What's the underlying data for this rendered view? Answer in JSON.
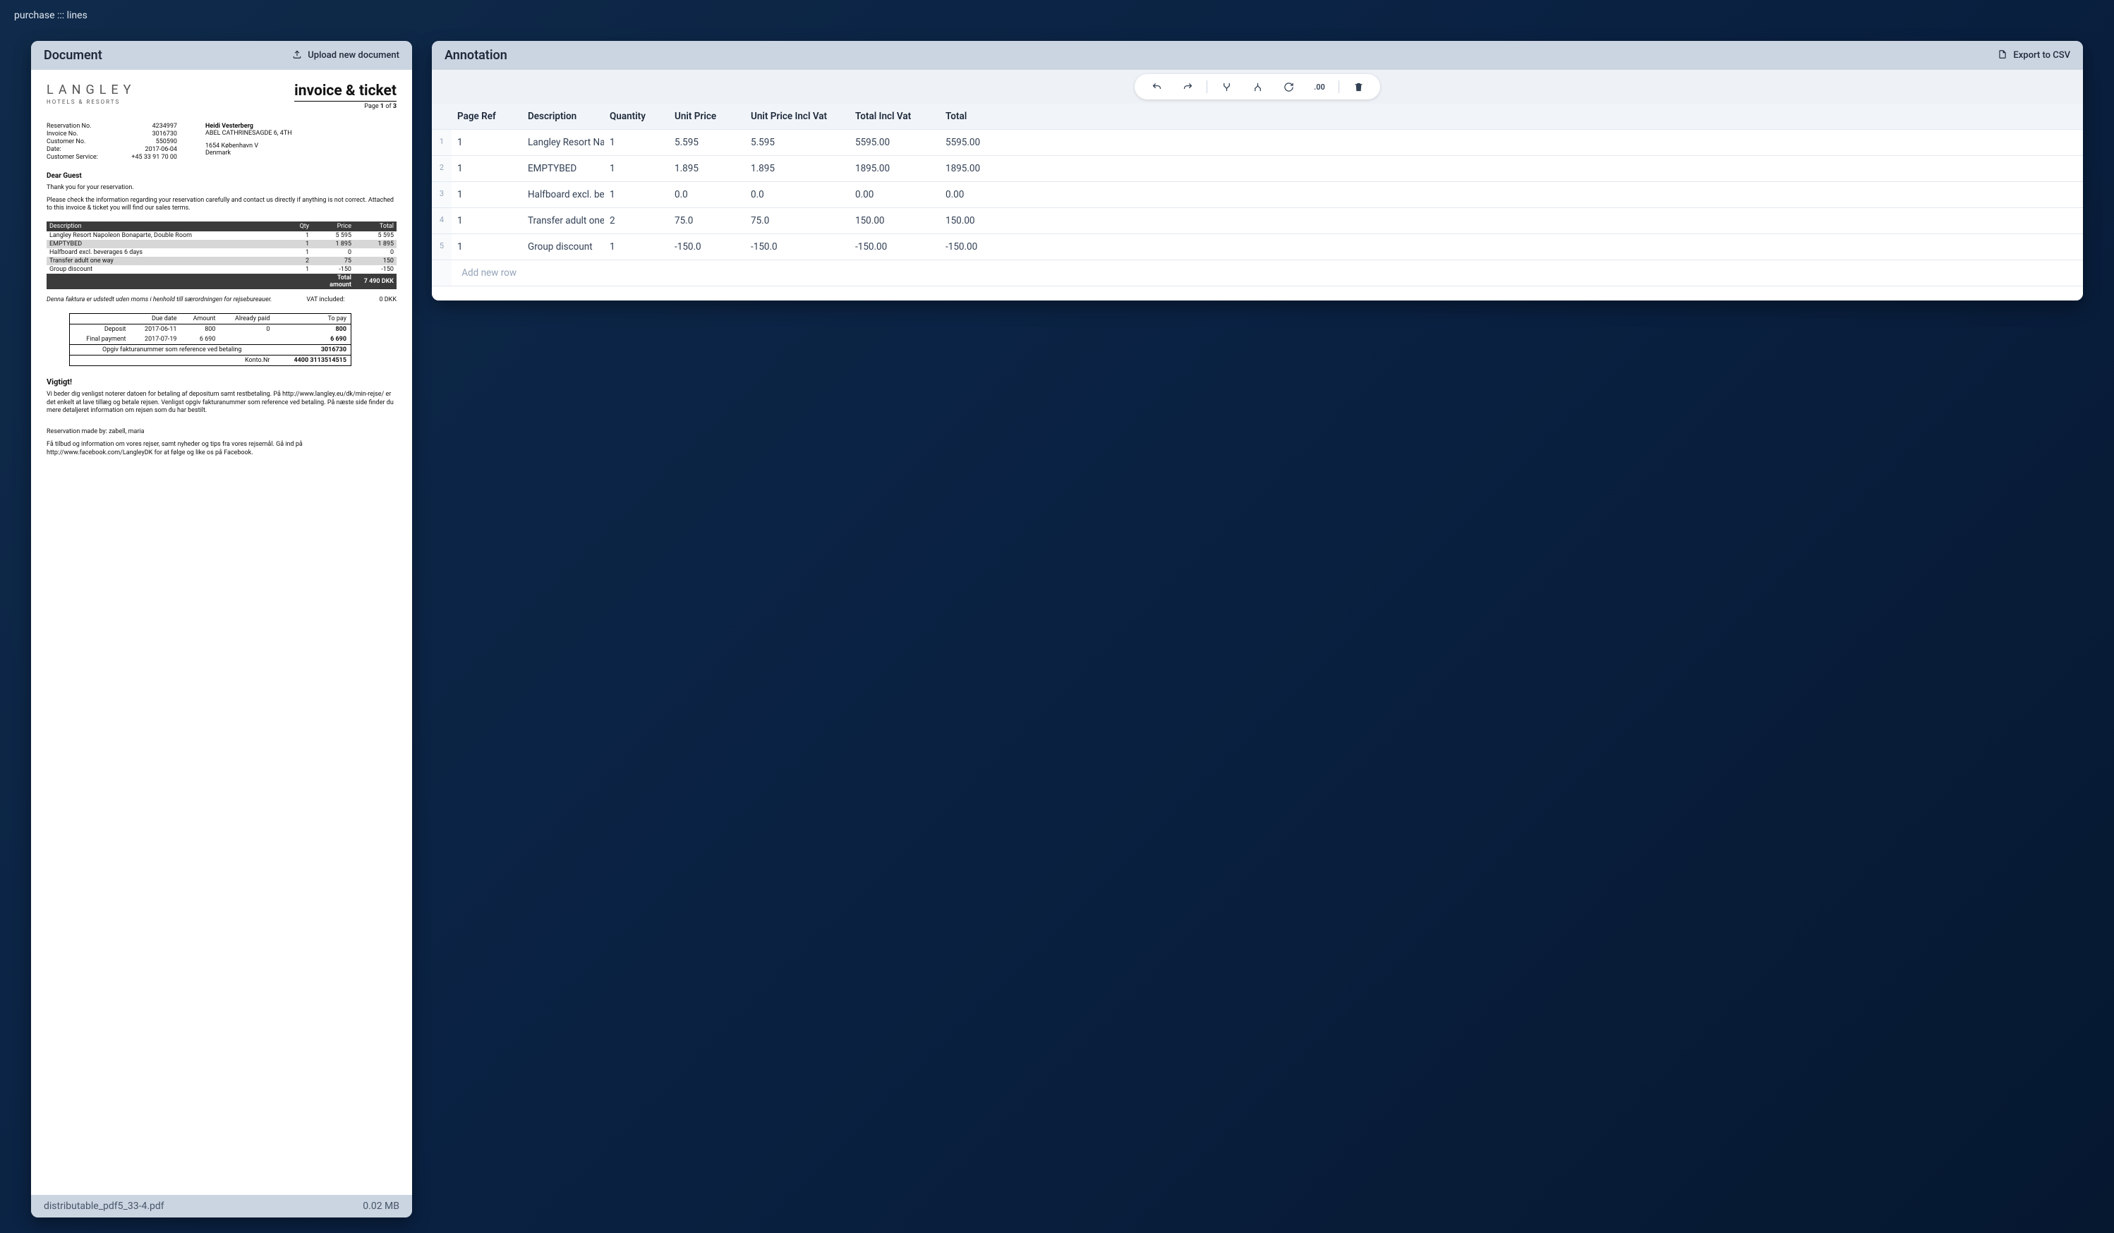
{
  "breadcrumb": "purchase ::: lines",
  "document_panel": {
    "title": "Document",
    "upload_label": "Upload new document",
    "filename": "distributable_pdf5_33-4.pdf",
    "filesize": "0.02 MB"
  },
  "annotation_panel": {
    "title": "Annotation",
    "export_label": "Export to CSV",
    "add_row_label": "Add new row",
    "toolbar": {
      "decimal_label": ".00"
    },
    "columns": [
      "Page Ref",
      "Description",
      "Quantity",
      "Unit Price",
      "Unit Price Incl Vat",
      "Total Incl Vat",
      "Total"
    ],
    "rows": [
      {
        "idx": "1",
        "page_ref": "1",
        "description": "Langley Resort Na",
        "quantity": "1",
        "unit_price": "5.595",
        "unit_price_incl_vat": "5.595",
        "total_incl_vat": "5595.00",
        "total": "5595.00"
      },
      {
        "idx": "2",
        "page_ref": "1",
        "description": "EMPTYBED",
        "quantity": "1",
        "unit_price": "1.895",
        "unit_price_incl_vat": "1.895",
        "total_incl_vat": "1895.00",
        "total": "1895.00"
      },
      {
        "idx": "3",
        "page_ref": "1",
        "description": "Halfboard excl. be",
        "quantity": "1",
        "unit_price": "0.0",
        "unit_price_incl_vat": "0.0",
        "total_incl_vat": "0.00",
        "total": "0.00"
      },
      {
        "idx": "4",
        "page_ref": "1",
        "description": "Transfer adult one",
        "quantity": "2",
        "unit_price": "75.0",
        "unit_price_incl_vat": "75.0",
        "total_incl_vat": "150.00",
        "total": "150.00"
      },
      {
        "idx": "5",
        "page_ref": "1",
        "description": "Group discount",
        "quantity": "1",
        "unit_price": "-150.0",
        "unit_price_incl_vat": "-150.0",
        "total_incl_vat": "-150.00",
        "total": "-150.00"
      }
    ]
  },
  "invoice": {
    "logo_name": "LANGLEY",
    "logo_sub": "HOTELS & RESORTS",
    "title": "invoice & ticket",
    "page_line_prefix": "Page ",
    "page_current": "1",
    "page_of": " of ",
    "page_total": "3",
    "meta": {
      "reservation_label": "Reservation No.",
      "reservation_value": "4234997",
      "invoice_label": "Invoice No.",
      "invoice_value": "3016730",
      "customer_label": "Customer No.",
      "customer_value": "550590",
      "date_label": "Date:",
      "date_value": "2017-06-04",
      "service_label": "Customer Service:",
      "service_value": "+45 33 91 70 00"
    },
    "address": {
      "name": "Heidi Vesterberg",
      "line1": "ABEL CATHRINESAGDE 6, 4TH",
      "line2": "1654  København V",
      "line3": "Denmark"
    },
    "dear": "Dear Guest",
    "thanks": "Thank you for your reservation.",
    "check": "Please check the information regarding your reservation carefully and contact us directly if anything is not correct. Attached to this invoice & ticket you will find our sales terms.",
    "columns": {
      "desc": "Description",
      "qty": "Qty",
      "price": "Price",
      "total": "Total"
    },
    "lines": [
      {
        "desc": "Langley Resort Napoleon Bonaparte, Double Room",
        "qty": "1",
        "price": "5 595",
        "total": "5 595"
      },
      {
        "desc": "EMPTYBED",
        "qty": "1",
        "price": "1 895",
        "total": "1 895"
      },
      {
        "desc": "Halfboard excl. beverages 6 days",
        "qty": "1",
        "price": "0",
        "total": "0"
      },
      {
        "desc": "Transfer adult one way",
        "qty": "2",
        "price": "75",
        "total": "150"
      },
      {
        "desc": "Group discount",
        "qty": "1",
        "price": "-150",
        "total": "-150"
      }
    ],
    "total_label": "Total amount",
    "total_value": "7 490 DKK",
    "vat_note_left": "Denna faktura er udstedt uden moms i henhold till særordningen for rejsebureauer.",
    "vat_note_mid": "VAT included:",
    "vat_note_right": "0 DKK",
    "paybox": {
      "h_due": "Due date",
      "h_amount": "Amount",
      "h_paid": "Already paid",
      "h_topay": "To pay",
      "r1_label": "Deposit",
      "r1_due": "2017-06-11",
      "r1_amount": "800",
      "r1_paid": "0",
      "r1_topay": "800",
      "r2_label": "Final payment",
      "r2_due": "2017-07-19",
      "r2_amount": "6 690",
      "r2_paid": "",
      "r2_topay": "6 690",
      "ref_label": "Opgiv fakturanummer som reference ved betaling",
      "ref_value": "3016730",
      "konto_label": "Konto.Nr",
      "konto_value": "4400 3113514515"
    },
    "vigtigt": "Vigtigt!",
    "vigtigt_body": "Vi beder dig venligst noterer datoen for betaling af depositum samt restbetaling. På http://www.langley.eu/dk/min-rejse/ er det enkelt at lave  tillæg og betale rejsen. Venligst opgiv fakturanummer som reference ved betaling.   På næste side finder du mere detaljeret information om rejsen som du har bestilt.",
    "made_by": "Reservation made by: zabell, maria",
    "social": "Få tilbud og information om vores rejser, samt nyheder og tips fra vores rejsemål. Gå ind på http://www.facebook.com/LangleyDK for at følge og like os på Facebook."
  }
}
